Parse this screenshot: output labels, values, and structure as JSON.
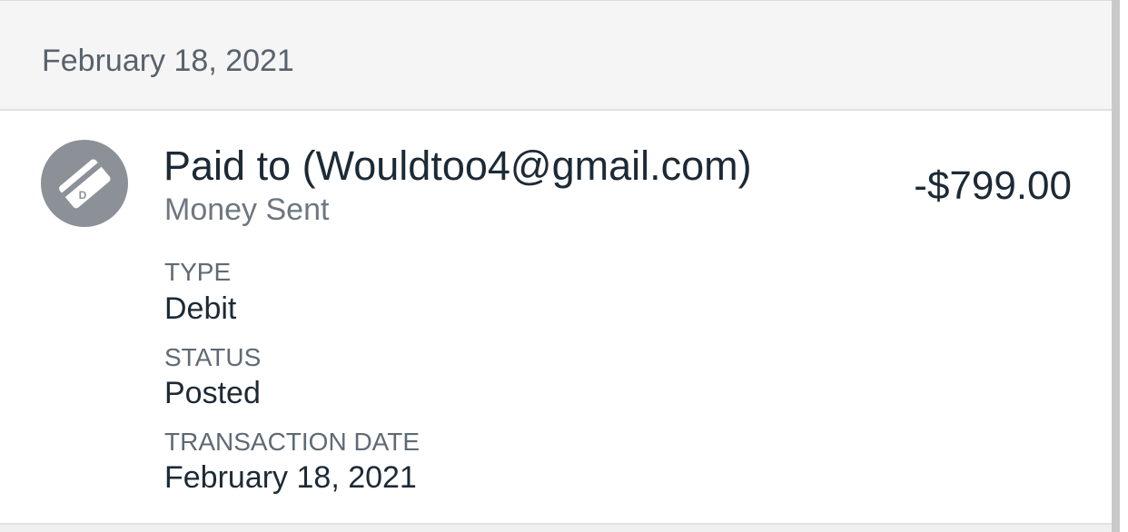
{
  "group": {
    "date": "February 18, 2021"
  },
  "transaction": {
    "icon": "debit-card-icon",
    "icon_letter": "D",
    "payee": "Paid to (Wouldtoo4@gmail.com)",
    "subtitle": "Money Sent",
    "amount": "-$799.00",
    "details": [
      {
        "label": "TYPE",
        "value": "Debit"
      },
      {
        "label": "STATUS",
        "value": "Posted"
      },
      {
        "label": "TRANSACTION DATE",
        "value": "February 18, 2021"
      }
    ]
  },
  "colors": {
    "header_background": "#f5f5f5",
    "header_text": "#58626d",
    "primary_text": "#1c2a36",
    "secondary_text": "#6e7780",
    "icon_background": "#8b9197"
  }
}
